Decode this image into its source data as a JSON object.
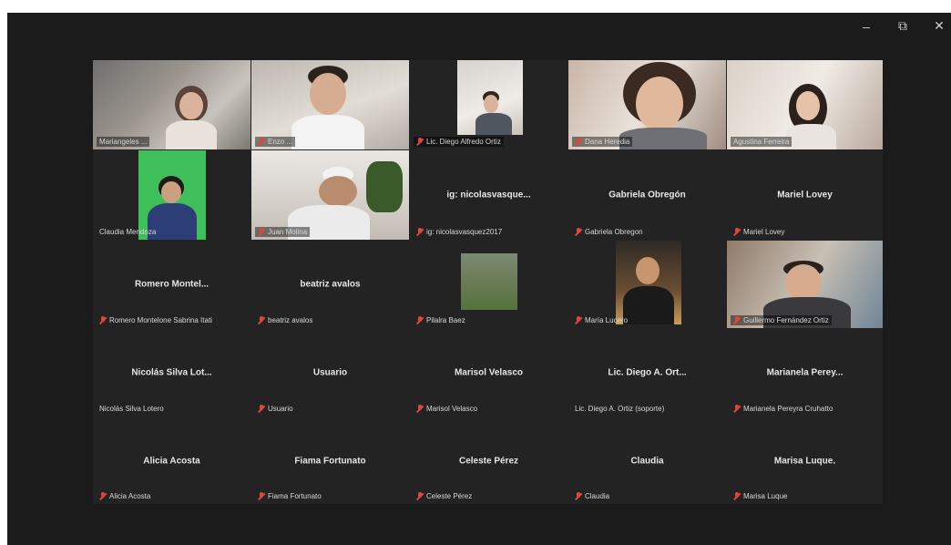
{
  "window": {
    "controls": {
      "minimize": "–",
      "maximize": "⧉",
      "close": "✕"
    }
  },
  "participants": [
    {
      "id": "p1",
      "label": "Mariangeles ...",
      "kind": "video",
      "muted": false,
      "active": true
    },
    {
      "id": "p2",
      "label": "Enzo ...",
      "kind": "video",
      "muted": true
    },
    {
      "id": "p3",
      "label": "Lic. Diego Alfredo Ortiz",
      "kind": "video",
      "muted": true
    },
    {
      "id": "p4",
      "label": "Dana Heredia",
      "kind": "video",
      "muted": true
    },
    {
      "id": "p5",
      "label": "Agustina Ferreira",
      "kind": "video",
      "muted": false
    },
    {
      "id": "p6",
      "label": "Claudia Mendoza",
      "kind": "video",
      "muted": false
    },
    {
      "id": "p7",
      "label": "Juan Molina",
      "kind": "video",
      "muted": true
    },
    {
      "id": "p8",
      "label": "ig: nicolasvasquez2017",
      "kind": "name",
      "display": "ig: nicolasvasque...",
      "muted": true
    },
    {
      "id": "p9",
      "label": "Gabriela Obregon",
      "kind": "name",
      "display": "Gabriela Obregón",
      "muted": true
    },
    {
      "id": "p10",
      "label": "Mariel Lovey",
      "kind": "name",
      "display": "Mariel Lovey",
      "muted": true
    },
    {
      "id": "p11",
      "label": "Romero Montelone Sabrina Itati",
      "kind": "name",
      "display": "Romero Montel...",
      "muted": true
    },
    {
      "id": "p12",
      "label": "beatriz avalos",
      "kind": "name",
      "display": "beatriz avalos",
      "muted": true
    },
    {
      "id": "p13",
      "label": "Pilalra Baez",
      "kind": "video",
      "muted": true
    },
    {
      "id": "p14",
      "label": "María Lucero",
      "kind": "video",
      "muted": true
    },
    {
      "id": "p15",
      "label": "Guillermo Fernández Ortiz",
      "kind": "video",
      "muted": true
    },
    {
      "id": "p16",
      "label": "Nicolás Silva Lotero",
      "kind": "name",
      "display": "Nicolás Silva Lot...",
      "muted": false
    },
    {
      "id": "p17",
      "label": "Usuario",
      "kind": "name",
      "display": "Usuario",
      "muted": true
    },
    {
      "id": "p18",
      "label": "Marisol Velasco",
      "kind": "name",
      "display": "Marisol Velasco",
      "muted": true
    },
    {
      "id": "p19",
      "label": "Lic. Diego A. Ortiz (soporte)",
      "kind": "name",
      "display": "Lic. Diego A. Ort...",
      "muted": false
    },
    {
      "id": "p20",
      "label": "Marianela Pereyra Cruhatto",
      "kind": "name",
      "display": "Marianela Perey...",
      "muted": true
    },
    {
      "id": "p21",
      "label": "Alicia Acosta",
      "kind": "name",
      "display": "Alicia Acosta",
      "muted": true
    },
    {
      "id": "p22",
      "label": "Fiama Fortunato",
      "kind": "name",
      "display": "Fiama Fortunato",
      "muted": true
    },
    {
      "id": "p23",
      "label": "Celeste Pérez",
      "kind": "name",
      "display": "Celeste Pérez",
      "muted": true
    },
    {
      "id": "p24",
      "label": "Claudia",
      "kind": "name",
      "display": "Claudia",
      "muted": true
    },
    {
      "id": "p25",
      "label": "Marisa Luque",
      "kind": "name",
      "display": "Marisa Luque.",
      "muted": true
    }
  ]
}
